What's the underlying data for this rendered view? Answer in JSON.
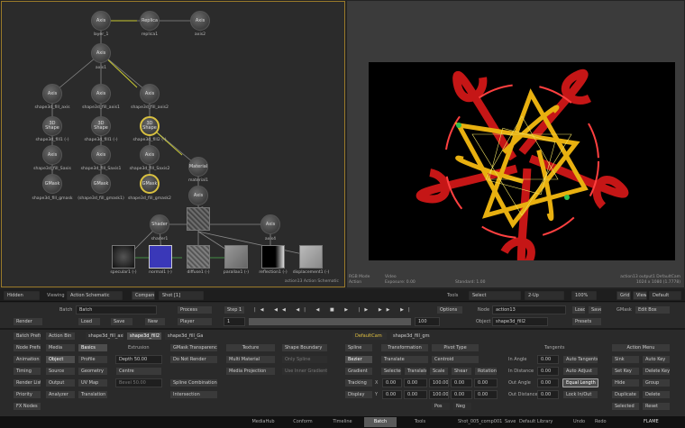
{
  "schematic": {
    "nodes": [
      {
        "id": "axis_top",
        "label": "Axis",
        "caption": "layer_1"
      },
      {
        "id": "replica",
        "label": "Replica",
        "caption": "replica1"
      },
      {
        "id": "axis2",
        "label": "Axis",
        "caption": "axis2"
      },
      {
        "id": "axis1",
        "label": "Axis",
        "caption": "axis1"
      },
      {
        "id": "axis_a",
        "label": "Axis",
        "caption": "shape3d_fill_axis"
      },
      {
        "id": "axis_b",
        "label": "Axis",
        "caption": "shape3d_fill_axis1"
      },
      {
        "id": "axis_c",
        "label": "Axis",
        "caption": "shape3d_fill_axis2"
      },
      {
        "id": "shape_a",
        "label": "3D Shape",
        "caption": "shape3d_fill1 (-)"
      },
      {
        "id": "shape_b",
        "label": "3D Shape",
        "caption": "shape3d_fill1 (-)"
      },
      {
        "id": "shape_c",
        "label": "3D Shape",
        "caption": "shape3d_fill2 (-)"
      },
      {
        "id": "axis_d",
        "label": "Axis",
        "caption": "shape3d_fill_Saxis"
      },
      {
        "id": "axis_e",
        "label": "Axis",
        "caption": "shape3d_fill_Saxis1"
      },
      {
        "id": "axis_f",
        "label": "Axis",
        "caption": "shape3d_fill_Saxis2"
      },
      {
        "id": "material",
        "label": "Material",
        "caption": "material1"
      },
      {
        "id": "gmask_a",
        "label": "GMask",
        "caption": "shape3d_fill_gmask"
      },
      {
        "id": "gmask_b",
        "label": "GMask",
        "caption": "(shape3d_fill_gmask1)"
      },
      {
        "id": "gmask_c",
        "label": "GMask",
        "caption": "shape3d_fill_gmask2"
      },
      {
        "id": "axis_g",
        "label": "Axis",
        "caption": "axis3"
      },
      {
        "id": "shader",
        "label": "Shader",
        "caption": "shader1"
      },
      {
        "id": "axis_h",
        "label": "Axis",
        "caption": "axis4"
      }
    ],
    "maps": [
      "specular1 (-)",
      "normal1 (-)",
      "diffuse1 (-)",
      "parallax1 (-)",
      "reflection1 (-)",
      "displacement1 (-)"
    ],
    "footer": "action13 Action Schematic"
  },
  "viewer": {
    "info_left": [
      "RGB Mode",
      "Action"
    ],
    "info_mid": [
      "Video",
      "Exposure: 0.00"
    ],
    "info_mid2": [
      "Standard: 1.00"
    ],
    "info_right": [
      "action13 output1 DefaultCam",
      "1024 x 1080 (1.7778)"
    ]
  },
  "bar1": {
    "hidden": "Hidden",
    "viewing_label": "Viewing",
    "viewing_value": "Action Schematic",
    "compare": "Compare",
    "compare_value": "Shot [1]",
    "tools": "Tools",
    "select": "Select",
    "layout": "2-Up",
    "zoom": "100%",
    "grid": "Grid",
    "view": "View",
    "default": "Default"
  },
  "transport": {
    "batch_label": "Batch",
    "batch_value": "Batch",
    "process": "Process",
    "render": "Render",
    "load": "Load",
    "save": "Save",
    "new": "New",
    "player": "Player",
    "step": "Step 1",
    "frame": "1",
    "end_frame": "100",
    "options": "Options",
    "node_label": "Node",
    "node_value": "action13",
    "object_label": "Object",
    "object_value": "shape3d_fill2",
    "load2": "Load",
    "save2": "Save",
    "presets": "Presets",
    "gmask": "GMask",
    "editbox": "Edit Box"
  },
  "tabs_row": {
    "batch_prefs": "Batch Prefs",
    "action_bin": "Action Bin",
    "t1": "shape3d_fill_axis2",
    "t2": "shape3d_fill2",
    "t3": "shape3d_fill_Gaxis",
    "defaultcam": "DefaultCam",
    "t4": "shape3d_fill_gmask"
  },
  "left_menu": [
    "Node Prefs",
    "Animation",
    "Timing",
    "Render List",
    "Priority",
    "FX Nodes"
  ],
  "left_menu2": [
    "Media",
    "Object",
    "Source",
    "Output",
    "Analyzer"
  ],
  "col3": [
    "Basics",
    "Profile",
    "Geometry",
    "UV Map",
    "Translation"
  ],
  "col4": {
    "header": "Extrusion",
    "depth": "Depth 50.00",
    "centre": "Centre",
    "bevel": "Bevel 50.00"
  },
  "col5": {
    "header": "GMask Transparency",
    "do_not_render": "Do Not Render",
    "spline_comb": "Spline Combination",
    "intersection": "Intersection"
  },
  "col6": {
    "header": "Texture",
    "multi": "Multi Material",
    "media_proj": "Media Projection"
  },
  "col7": {
    "header": "Shape Boundary",
    "only_spline": "Only Spline",
    "use_inner": "Use Inner Gradients"
  },
  "col8": {
    "spline": "Spline",
    "bezier": "Bezier",
    "gradient": "Gradient",
    "tracking": "Tracking",
    "display": "Display"
  },
  "col9": {
    "transformation": "Transformation",
    "pivot_type": "Pivot Type",
    "translate": "Translate",
    "centroid": "Centroid",
    "selected": "Selected",
    "translate_b": "Translate",
    "scale": "Scale",
    "shear": "Shear",
    "rotation": "Rotation",
    "x": "X",
    "y": "Y",
    "pos": "Pos",
    "neg": "Neg"
  },
  "xyz_vals": [
    "0.00",
    "0.00",
    "0.00",
    "0.00",
    "0.00",
    "100.00",
    "100.00",
    "0.00",
    "0.00",
    "0.00"
  ],
  "tangents": {
    "header": "Tangents",
    "in_angle": "In Angle",
    "in_distance": "In Distance",
    "out_angle": "Out Angle",
    "out_distance": "Out Distance",
    "val": "0.00",
    "auto_tangents": "Auto Tangents",
    "auto_adjust": "Auto Adjust",
    "equal_length": "Equal Length",
    "lock_in_out": "Lock In/Out"
  },
  "action_menu": {
    "header": "Action Menu",
    "items": [
      "Sink",
      "Auto Key",
      "Set Key",
      "Delete Key",
      "Hide",
      "Group",
      "Duplicate",
      "Delete",
      "Selected",
      "Reset"
    ]
  },
  "taskbar": {
    "tabs": [
      "MediaHub",
      "Conform",
      "Timeline",
      "Batch",
      "Tools"
    ],
    "active": "Batch",
    "shot": "Shot_005_comp001",
    "save": "Save",
    "library": "Default Library",
    "undo": "Undo",
    "redo": "Redo",
    "logo": "FLAME"
  },
  "colors": {
    "accent_gold": "#d8c040",
    "selected_border": "#9a7a2a"
  }
}
